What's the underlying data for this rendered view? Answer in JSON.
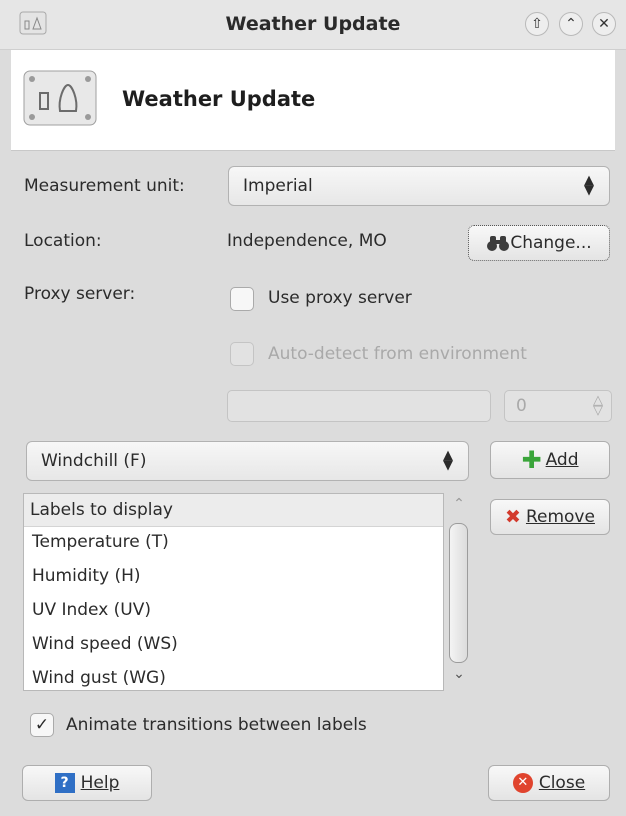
{
  "window": {
    "title": "Weather Update"
  },
  "header": {
    "title": "Weather Update"
  },
  "form": {
    "measurement_label": "Measurement unit:",
    "measurement_value": "Imperial",
    "location_label": "Location:",
    "location_value": "Independence, MO",
    "change_label": "Change...",
    "proxy_label": "Proxy server:",
    "use_proxy_label": "Use proxy server",
    "autodetect_label": "Auto-detect from environment",
    "proxy_host_value": "",
    "proxy_port_value": "0"
  },
  "labels": {
    "selector_value": "Windchill (F)",
    "add_label": "Add",
    "remove_label": "Remove",
    "list_header": "Labels to display",
    "items": [
      "Temperature (T)",
      "Humidity (H)",
      "UV Index (UV)",
      "Wind speed (WS)",
      "Wind gust (WG)"
    ]
  },
  "animate_label": "Animate transitions between labels",
  "footer": {
    "help_label": "Help",
    "close_label": "Close"
  },
  "icons": [
    "app-icon",
    "keep-above-icon",
    "minimize-icon",
    "close-window-icon",
    "binoculars-icon",
    "plus-icon",
    "remove-x-icon",
    "help-icon",
    "close-circle-icon",
    "checkmark-icon"
  ],
  "colors": {
    "accent_green": "#3aa53a",
    "remove_red": "#d33a2c",
    "help_blue": "#2f6fc5",
    "close_red": "#e0442e"
  }
}
